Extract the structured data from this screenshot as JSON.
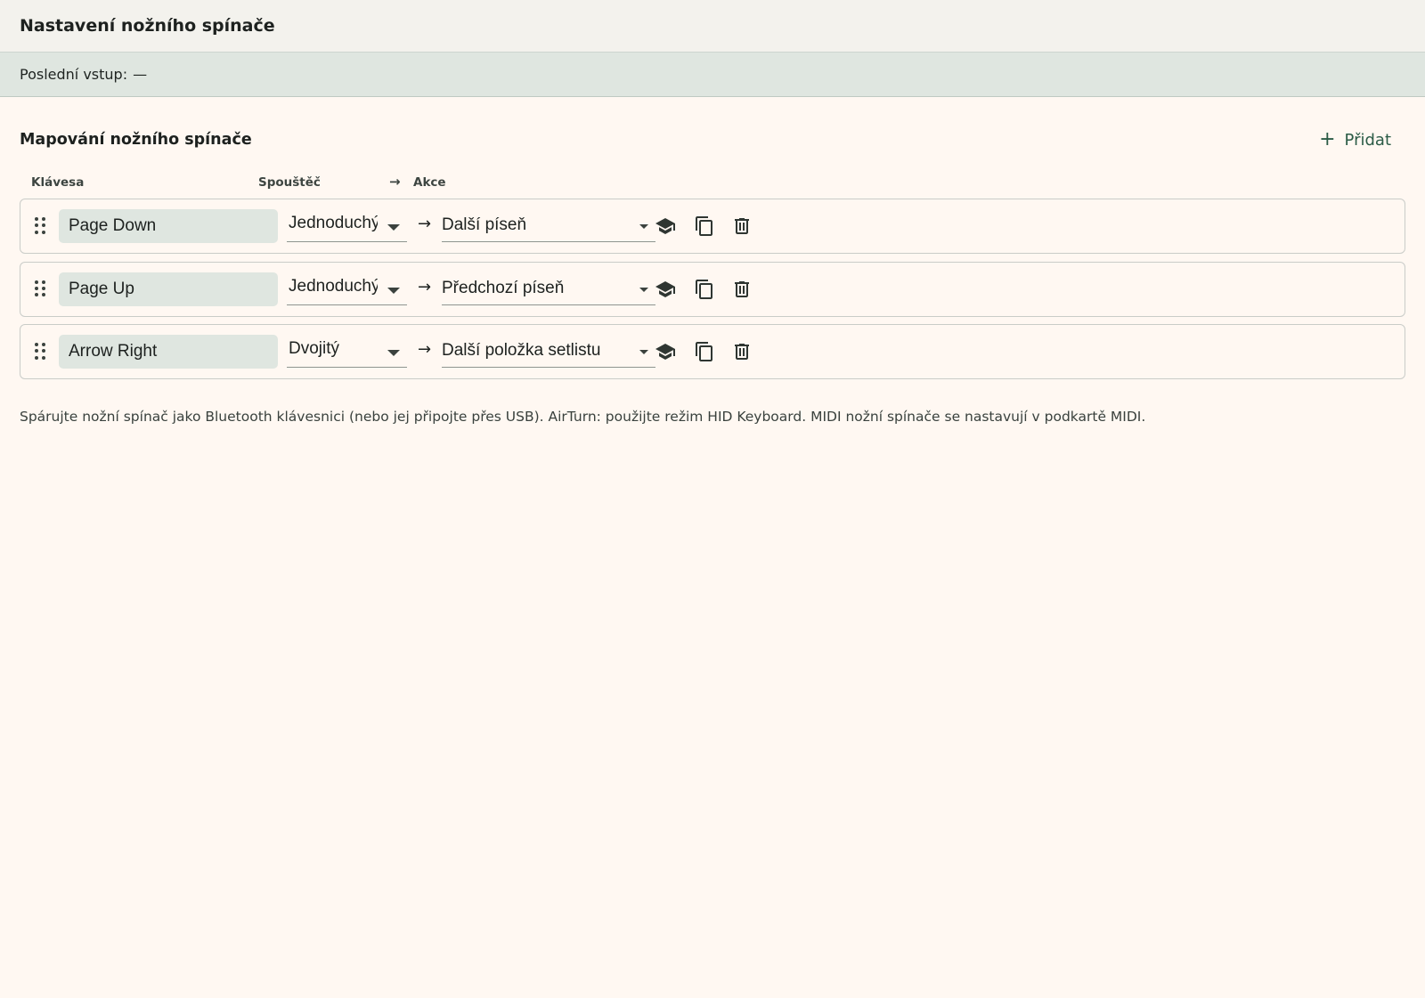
{
  "header": {
    "title": "Nastavení nožního spínače"
  },
  "status": {
    "label": "Poslední vstup:",
    "value": "—"
  },
  "section": {
    "title": "Mapování nožního spínače",
    "add_label": "Přidat",
    "add_icon": "plus-icon"
  },
  "columns": {
    "key": "Klávesa",
    "trigger": "Spouštěč",
    "arrow": "→",
    "action": "Akce"
  },
  "mappings": [
    {
      "key": "Page Down",
      "trigger": "Jednoduchý",
      "action": "Další píseň"
    },
    {
      "key": "Page Up",
      "trigger": "Jednoduchý",
      "action": "Předchozí píseň"
    },
    {
      "key": "Arrow Right",
      "trigger": "Dvojitý",
      "action": "Další položka setlistu"
    }
  ],
  "row_icons": [
    "drag-handle-icon",
    "learn-icon",
    "copy-icon",
    "delete-icon"
  ],
  "arrow_glyph": "→",
  "note": "Spárujte nožní spínač jako Bluetooth klávesnici (nebo jej připojte přes USB). AirTurn: použijte režim HID Keyboard. MIDI nožní spínače se nastavují v podkartě MIDI.",
  "colors": {
    "background": "#fff8f2",
    "header": "#f3f2ed",
    "status_bar": "#dfe6e0",
    "accent": "#2b5b46",
    "field": "#dfe6e0"
  }
}
